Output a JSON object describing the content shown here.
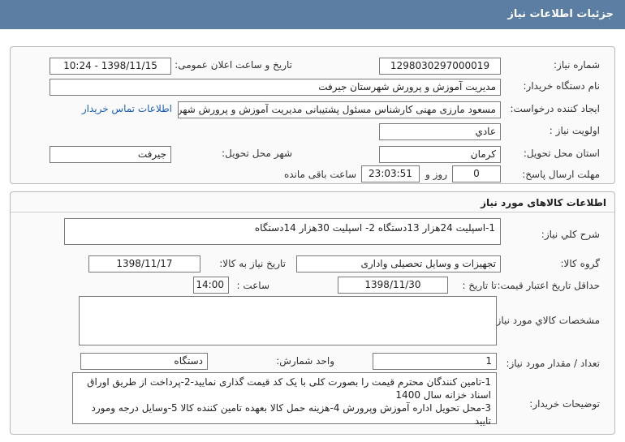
{
  "header": {
    "title": "جزئیات اطلاعات نیاز"
  },
  "info": {
    "need_number_label": "شماره نیاز:",
    "need_number": "1298030297000019",
    "announce_label": "تاریخ و ساعت اعلان عمومی:",
    "announce_value": "1398/11/15 - 10:24",
    "buyer_label": "نام دستگاه خریدار:",
    "buyer_value": "مدیریت آموزش و پرورش شهرستان جیرفت",
    "creator_label": "ایجاد کننده درخواست:",
    "creator_value": "مسعود  مارزی مهنی  کارشناس مسئول پشتیبانی  مدیریت آموزش و پرورش شهرستان جیرفت",
    "contact_link": "اطلاعات تماس خریدار",
    "priority_label": "اولویت نیاز :",
    "priority_value": "عادي",
    "province_label": "استان محل تحویل:",
    "province_value": "کرمان",
    "city_label": "شهر محل تحویل:",
    "city_value": "جیرفت",
    "deadline_label": "مهلت ارسال پاسخ:",
    "deadline_days": "0",
    "days_word": "روز و",
    "deadline_time": "23:03:51",
    "remaining_word": "ساعت باقی مانده"
  },
  "goods": {
    "section_title": "اطلاعات کالاهای مورد نیاز",
    "general_label": "شرح کلي نیاز:",
    "general_value": "1-اسپلیت 24هزار 13دستگاه  2- اسپلیت 30هزار 14دستگاه",
    "group_label": "گروه کالا:",
    "group_value": "تجهیزات و وسایل تحصیلی واداری",
    "need_date_label": "تاریخ نیاز به کالا:",
    "need_date_value": "1398/11/17",
    "min_validity_label": "حداقل تاریخ اعتبار قیمت:",
    "until_date_label": "تا تاریخ :",
    "until_date_value": "1398/11/30",
    "time_label": "ساعت :",
    "time_value": "14:00",
    "specs_label": "مشخصات کالاي مورد نیاز:",
    "specs_value": "",
    "qty_label": "تعداد / مقدار مورد نیاز:",
    "qty_value": "1",
    "unit_label": "واحد شمارش:",
    "unit_value": "دستگاه",
    "notes_label": "توضیحات خریدار:",
    "notes_value": "1-تامین کنندگان محترم قیمت را بصورت کلی با یک کد قیمت گذاری نمایید-2-پرداخت از طریق اوراق اسناد خزانه سال 1400\n3-محل تحویل اداره آموزش وپرورش 4-هزینه حمل کالا بعهده تامین کننده کالا 5-وسایل درجه ومورد تایید"
  }
}
